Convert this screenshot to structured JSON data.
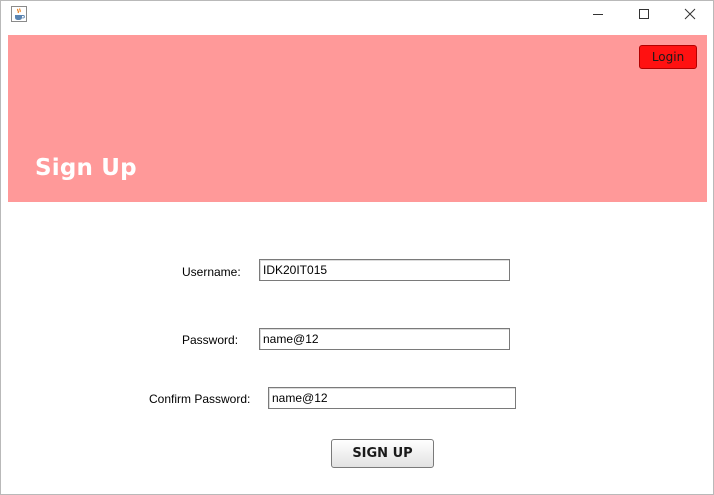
{
  "window": {
    "app_icon": "java-cup-icon",
    "controls": {
      "minimize_icon": "minimize-icon",
      "maximize_icon": "maximize-icon",
      "close_icon": "close-icon"
    }
  },
  "header": {
    "title": "Sign Up",
    "login_label": "Login",
    "background_color": "#ff9999",
    "login_color": "#ff1111"
  },
  "form": {
    "username_label": "Username:",
    "username_value": "IDK20IT015",
    "password_label": "Password:",
    "password_value": "name@12",
    "confirm_label": "Confirm Password:",
    "confirm_value": "name@12",
    "submit_label": "SIGN UP"
  }
}
